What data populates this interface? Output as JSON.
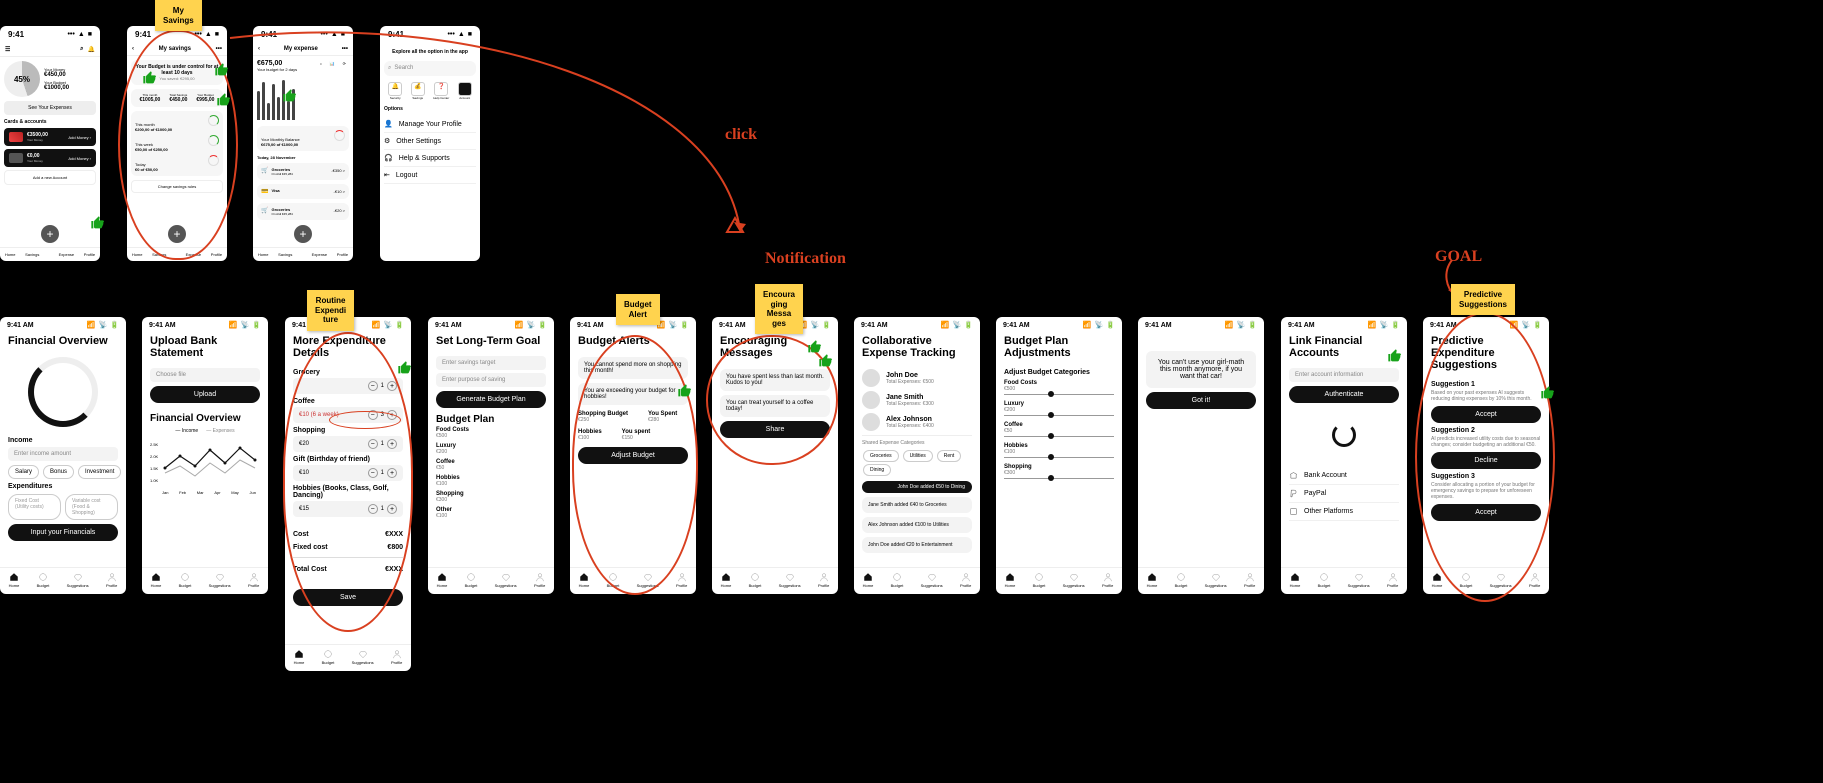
{
  "status": {
    "time_a": "9:41",
    "time_b": "9:41 AM"
  },
  "stickies": {
    "my_savings": "My\nSavings",
    "routine_exp": "Routine\nExpendi\nture",
    "budget_alert": "Budget\nAlert",
    "encouraging": "Encoura\nging\nMessa\nges",
    "predictive": "Predictive\nSuggestions"
  },
  "hand": {
    "click": "click",
    "notification": "Notification",
    "goal": "GOAL"
  },
  "nav": {
    "home": "Home",
    "budget": "Budget",
    "suggestions": "Suggestions",
    "profile": "Profile",
    "savings": "Savings",
    "expense": "Expense"
  },
  "s1": {
    "percent": "45%",
    "ylabel": "Your Money",
    "ymoney": "€450,00",
    "blabel": "Your Budget",
    "bmoney": "€1000,00",
    "see": "See Your Expenses",
    "cards_h": "Cards & accounts",
    "c1_amt": "€3500,00",
    "c1_sub": "Your Money",
    "add": "Add Money",
    "c2_amt": "€0,00",
    "c2_sub": "Your Money",
    "add_acct": "Add a new Account"
  },
  "s2": {
    "title": "My savings",
    "banner": "Your Budget is under control for at least 10 days",
    "banner_sub": "You saved: €295,00",
    "m_label": "This month",
    "m_val": "€1005,00",
    "t_label": "Total Savings",
    "t_val": "€450,00",
    "b_label": "Your Budget",
    "b_val": "€995,00",
    "r1": "This month",
    "r1_v": "€200,00 of €1000,00",
    "r2": "This week",
    "r2_v": "€50,00 of €250,00",
    "r3": "Today",
    "r3_v": "€0 of €50,00",
    "change": "Change savings rules"
  },
  "s3": {
    "title": "My expense",
    "amt": "€675,00",
    "sub": "Your budget for 2 days",
    "cat": "Your Monthly Balance",
    "cat_v": "€675,00 of €1000,00",
    "today": "Today, 28 November",
    "t1": "Groceries",
    "t1_sub": "On Aldi €45,284",
    "t1_amt": "-€350 >",
    "t2": "Visa",
    "t2_sub": "",
    "t2_amt": "-€10 >",
    "t3": "Groceries",
    "t3_sub": "On Aldi €45,284",
    "t3_amt": "-€20 >"
  },
  "s4": {
    "title": "Explore all the option in the app",
    "search": "Search",
    "i1": "Security",
    "i2": "Savings",
    "i3": "Help Center",
    "i4": "Account",
    "opt": "Options",
    "o1": "Manage Your Profile",
    "o2": "Other Settings",
    "o3": "Help & Supports",
    "o4": "Logout"
  },
  "fo": {
    "title": "Financial Overview",
    "income": "Income",
    "income_ph": "Enter income amount",
    "p1": "Salary",
    "p2": "Bonus",
    "p3": "Investment",
    "exp": "Expenditures",
    "e1": "Fixed Cost (Utility costs)",
    "e2": "Variable cost (Food & Shopping)",
    "btn": "Input your Financials"
  },
  "ub": {
    "title": "Upload Bank Statement",
    "ph": "Choose file",
    "btn": "Upload",
    "ov": "Financial Overview",
    "legend1": "Income",
    "legend2": "Expenses",
    "months": [
      "Jan",
      "Feb",
      "Mar",
      "Apr",
      "May",
      "Jun"
    ]
  },
  "me": {
    "title": "More Expenditure Details",
    "grocery": "Grocery",
    "coffee": "Coffee",
    "coffee_v": "€10 (6 a week)",
    "shopping": "Shopping",
    "shopping_v": "€20",
    "gift": "Gift (Birthday of friend)",
    "gift_v": "€10",
    "hobbies": "Hobbies (Books, Class, Golf, Dancing)",
    "hobbies_v": "€15",
    "cost": "Cost",
    "cost_v": "€XXX",
    "fixed": "Fixed cost",
    "fixed_v": "€800",
    "total": "Total Cost",
    "total_v": "€XXX",
    "save": "Save"
  },
  "sl": {
    "title": "Set Long-Term Goal",
    "ph1": "Enter savings target",
    "ph2": "Enter purpose of saving",
    "btn": "Generate Budget Plan",
    "plan": "Budget Plan",
    "i1": "Food Costs",
    "v1": "€500",
    "i2": "Luxury",
    "v2": "€200",
    "i3": "Coffee",
    "v3": "€50",
    "i4": "Hobbies",
    "v4": "€100",
    "i5": "Shopping",
    "v5": "€300",
    "i6": "Other",
    "v6": "€100"
  },
  "ba": {
    "title": "Budget Alerts",
    "m1": "You cannot spend more on shopping this month!",
    "m2": "You are exceeding your budget for hobbies!",
    "c1": "Shopping Budget",
    "c1v": "€250",
    "c2": "You Spent",
    "c2v": "€280",
    "c3": "Hobbies",
    "c3v": "€100",
    "c4": "You spent",
    "c4v": "€150",
    "btn": "Adjust Budget"
  },
  "em": {
    "title": "Encouraging Messages",
    "m1": "You have spent less than last month. Kudos to you!",
    "m2": "You can treat yourself to a coffee today!",
    "btn": "Share"
  },
  "ce": {
    "title": "Collaborative Expense Tracking",
    "p1": "John Doe",
    "p1s": "Total Expenses: €500",
    "p2": "Jane Smith",
    "p2s": "Total Expenses: €300",
    "p3": "Alex Johnson",
    "p3s": "Total Expenses: €400",
    "sh": "Shared Expense Categories",
    "chips": [
      "Groceries",
      "Utilities",
      "Rent",
      "Dining"
    ],
    "tag": "John Doe added €50 to Dining",
    "e1": "Jane Smith added €40 to Groceries",
    "e2": "Alex Johnson added €100 to Utilities",
    "e3": "John Doe added €20 to Entertainment"
  },
  "bp": {
    "title": "Budget Plan Adjustments",
    "sub": "Adjust Budget Categories",
    "c1": "Food Costs",
    "v1": "€500",
    "c2": "Luxury",
    "v2": "€200",
    "c3": "Coffee",
    "v3": "€50",
    "c4": "Hobbies",
    "v4": "€100",
    "c5": "Shopping",
    "v5": "€300"
  },
  "gm": {
    "msg": "You can't use your girl-math this month anymore, if you want that car!",
    "btn": "Got it!"
  },
  "lf": {
    "title": "Link Financial Accounts",
    "ph": "Enter account information",
    "btn": "Authenticate",
    "o1": "Bank Account",
    "o2": "PayPal",
    "o3": "Other Platforms"
  },
  "pe": {
    "title": "Predictive Expenditure Suggestions",
    "s1": "Suggestion 1",
    "s1d": "Based on your past expenses AI suggests reducing dining expenses by 10% this month.",
    "s2": "Suggestion 2",
    "s2d": "AI predicts increased utility costs due to seasonal changes; consider budgeting an additional €50.",
    "s3": "Suggestion 3",
    "s3d": "Consider allocating a portion of your budget for emergency savings to prepare for unforeseen expenses.",
    "accept": "Accept",
    "decline": "Decline"
  }
}
